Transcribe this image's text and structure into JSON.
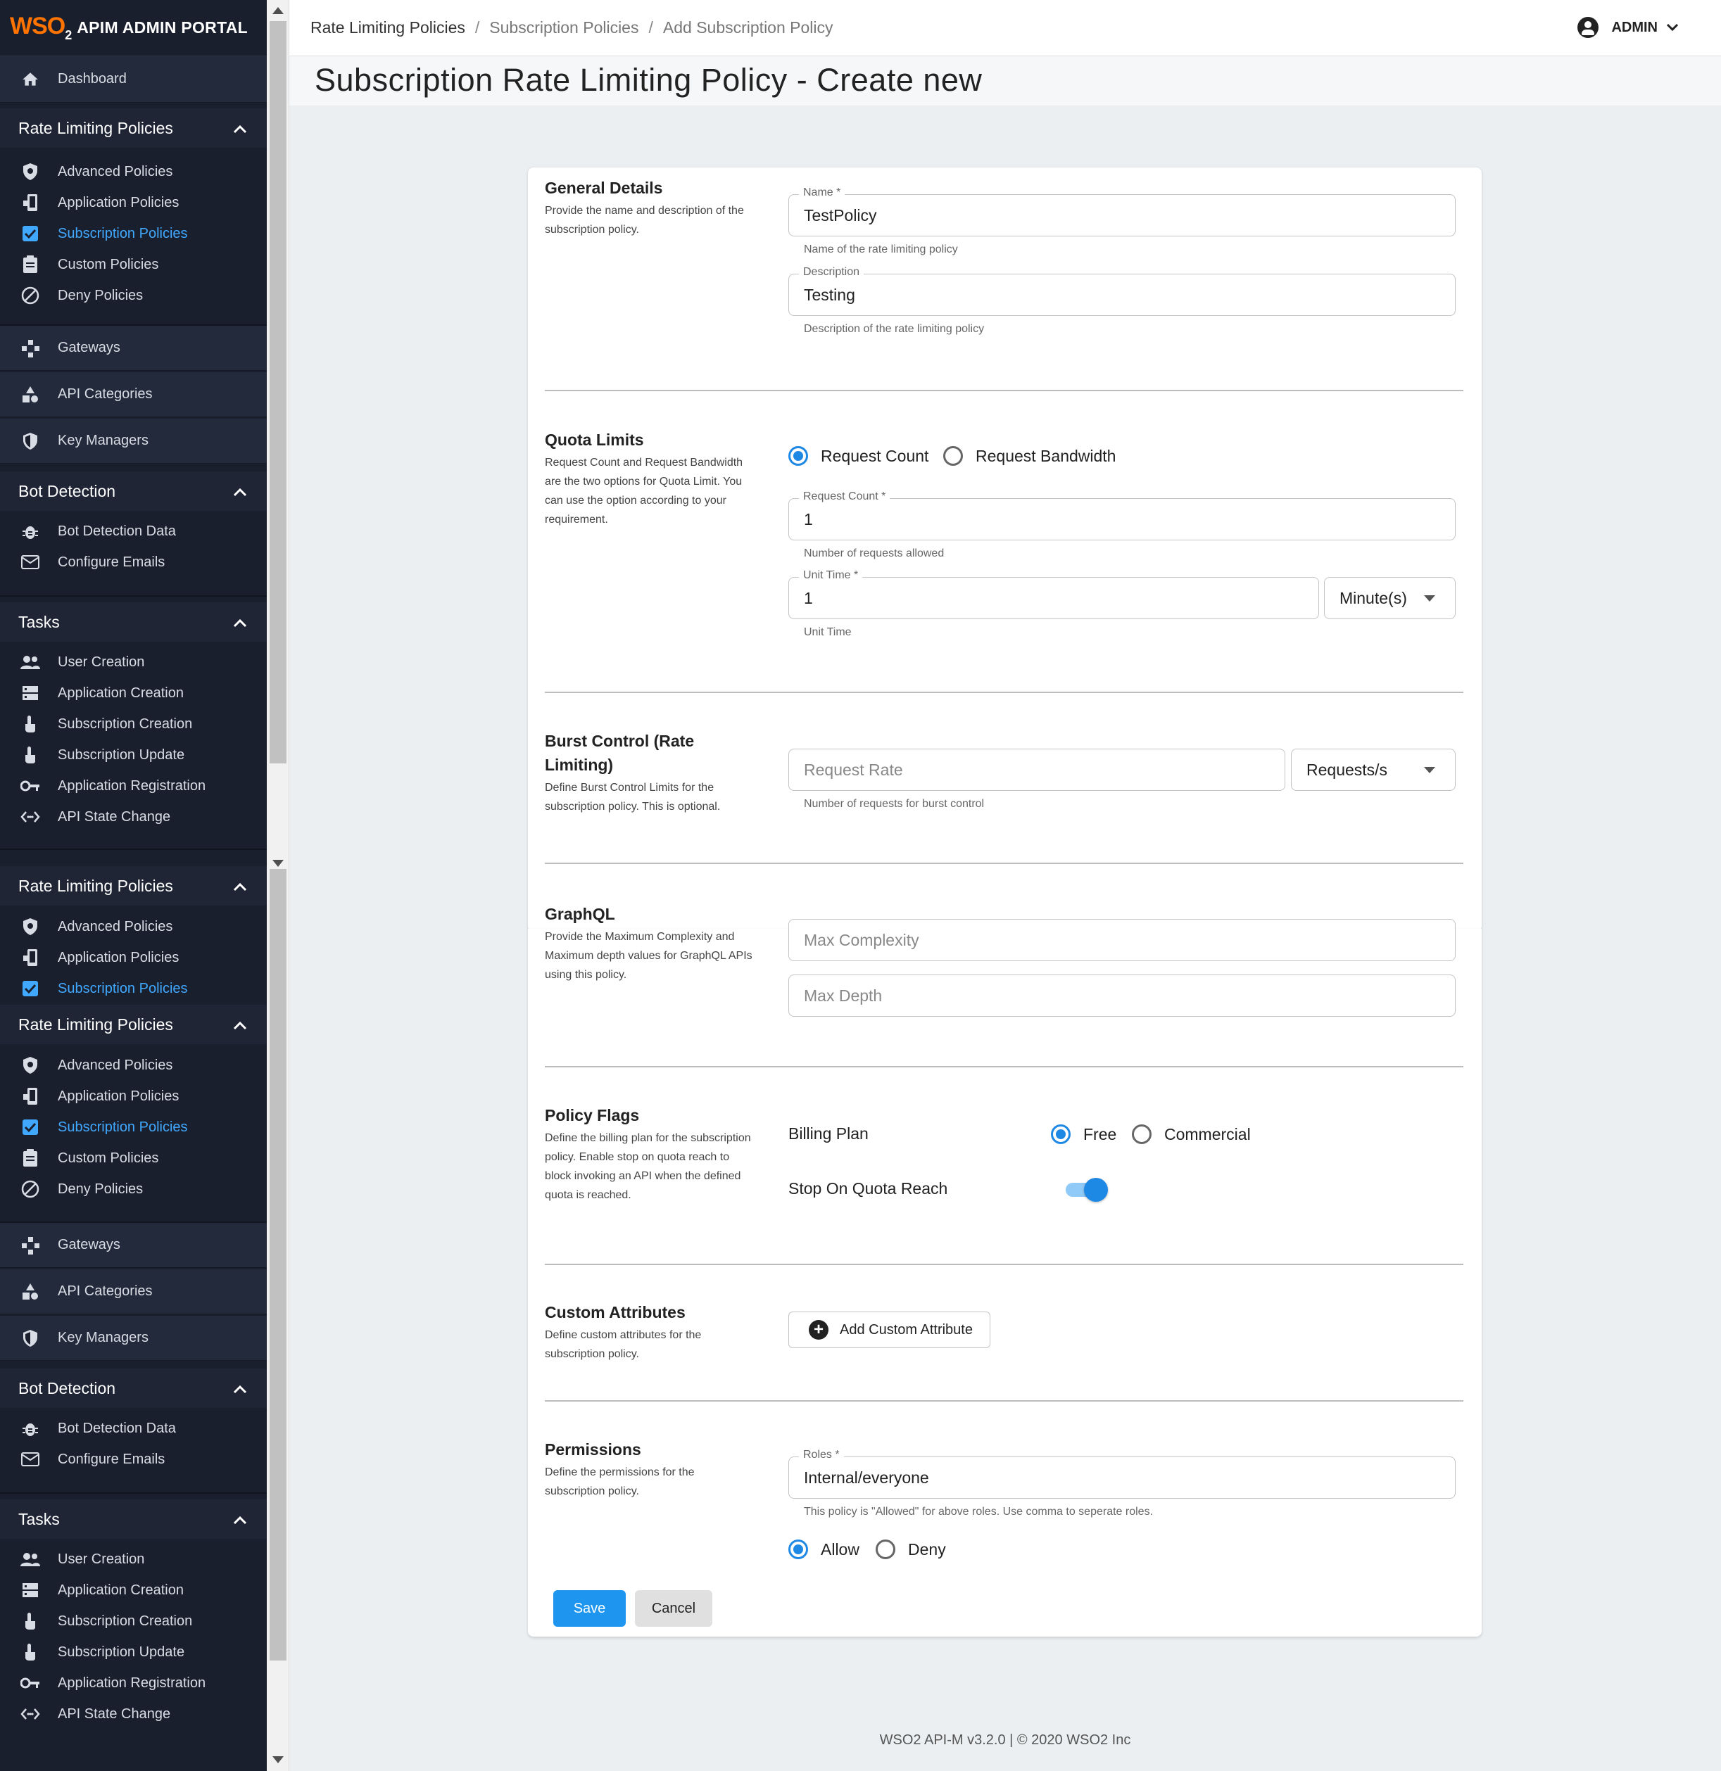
{
  "brand": {
    "logo": "WSO",
    "logo_sub": "2",
    "title": "APIM ADMIN PORTAL"
  },
  "sidebar": {
    "dashboard": "Dashboard",
    "rate_limiting_header": "Rate Limiting Policies",
    "advanced_policies": "Advanced Policies",
    "application_policies": "Application Policies",
    "subscription_policies": "Subscription Policies",
    "custom_policies": "Custom Policies",
    "deny_policies": "Deny Policies",
    "gateways": "Gateways",
    "api_categories": "API Categories",
    "key_managers": "Key Managers",
    "bot_detection_header": "Bot Detection",
    "bot_detection_data": "Bot Detection Data",
    "configure_emails": "Configure Emails",
    "tasks_header": "Tasks",
    "user_creation": "User Creation",
    "application_creation": "Application Creation",
    "subscription_creation": "Subscription Creation",
    "subscription_update": "Subscription Update",
    "application_registration": "Application Registration",
    "api_state_change": "API State Change"
  },
  "breadcrumb": {
    "first": "Rate Limiting Policies",
    "second": "Subscription Policies",
    "third": "Add Subscription Policy",
    "separator": "/"
  },
  "user": {
    "name": "ADMIN"
  },
  "page_title": "Subscription Rate Limiting Policy - Create new",
  "general": {
    "title": "General Details",
    "desc": "Provide the name and description of the subscription policy.",
    "name_label": "Name *",
    "name_value": "TestPolicy",
    "name_help": "Name of the rate limiting policy",
    "desc_label": "Description",
    "desc_value": "Testing",
    "desc_help": "Description of the rate limiting policy"
  },
  "quota": {
    "title": "Quota Limits",
    "desc": "Request Count and Request Bandwidth are the two options for Quota Limit. You can use the option according to your requirement.",
    "opt_count": "Request Count",
    "opt_bandwidth": "Request Bandwidth",
    "count_label": "Request Count *",
    "count_value": "1",
    "count_help": "Number of requests allowed",
    "unit_label": "Unit Time *",
    "unit_value": "1",
    "unit_select": "Minute(s)",
    "unit_help": "Unit Time"
  },
  "burst": {
    "title_line1": "Burst Control (Rate",
    "title_line2": "Limiting)",
    "desc": "Define Burst Control Limits for the subscription policy. This is optional.",
    "rate_placeholder": "Request Rate",
    "rate_select": "Requests/s",
    "rate_help": "Number of requests for burst control"
  },
  "graphql": {
    "title": "GraphQL",
    "desc": "Provide the Maximum Complexity and Maximum depth values for GraphQL APIs using this policy.",
    "complexity_placeholder": "Max Complexity",
    "depth_placeholder": "Max Depth"
  },
  "flags": {
    "title": "Policy Flags",
    "desc": "Define the billing plan for the subscription policy. Enable stop on quota reach to block invoking an API when the defined quota is reached.",
    "billing_label": "Billing Plan",
    "opt_free": "Free",
    "opt_commercial": "Commercial",
    "stop_label": "Stop On Quota Reach"
  },
  "custom_attrs": {
    "title": "Custom Attributes",
    "desc": "Define custom attributes for the subscription policy.",
    "add_button": "Add Custom Attribute"
  },
  "permissions": {
    "title": "Permissions",
    "desc": "Define the permissions for the subscription policy.",
    "roles_label": "Roles *",
    "roles_value": "Internal/everyone",
    "roles_help": "This policy is \"Allowed\" for above roles. Use comma to seperate roles.",
    "opt_allow": "Allow",
    "opt_deny": "Deny"
  },
  "actions": {
    "save": "Save",
    "cancel": "Cancel"
  },
  "footer": "WSO2 API-M v3.2.0 | © 2020 WSO2 Inc",
  "colors": {
    "accent": "#1e88e5",
    "sidebar_bg": "#1a1f2e",
    "active_link": "#40a9ff",
    "brand_orange": "#ff7300"
  }
}
